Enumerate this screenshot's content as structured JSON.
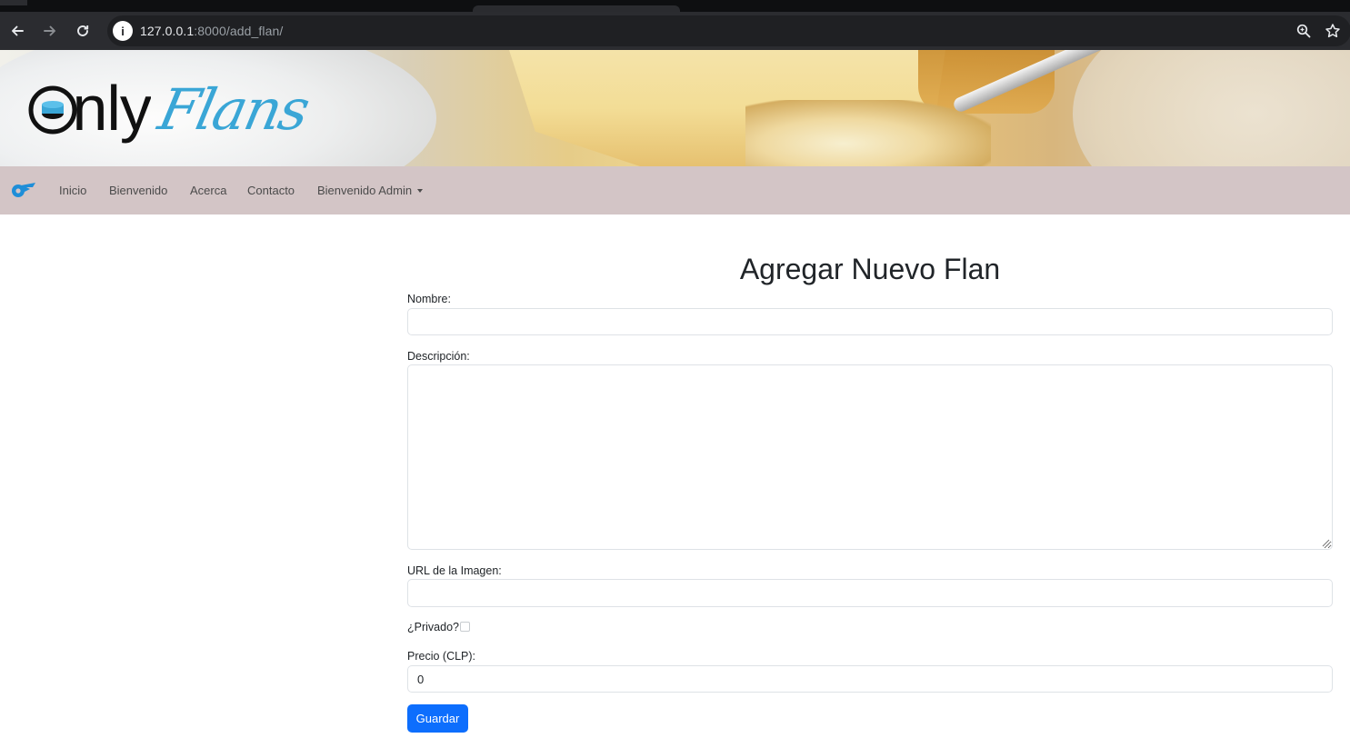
{
  "browser": {
    "url_host": "127.0.0.1",
    "url_path": ":8000/add_flan/"
  },
  "banner": {
    "logo_text_main": "Only",
    "logo_text_script": "Flans"
  },
  "navbar": {
    "items": [
      {
        "label": "Inicio"
      },
      {
        "label": "Bienvenido"
      },
      {
        "label": "Acerca"
      },
      {
        "label": "Contacto"
      },
      {
        "label": "Bienvenido Admin"
      }
    ]
  },
  "form": {
    "title": "Agregar Nuevo Flan",
    "nombre_label": "Nombre:",
    "nombre_value": "",
    "descripcion_label": "Descripción:",
    "descripcion_value": "",
    "imagen_label": "URL de la Imagen:",
    "imagen_value": "",
    "privado_label": "¿Privado?",
    "privado_checked": false,
    "precio_label": "Precio (CLP):",
    "precio_value": "0",
    "submit_label": "Guardar"
  },
  "colors": {
    "navbar_bg": "#d3c5c6",
    "primary": "#0d6efd",
    "logo_accent": "#3aa6d6"
  }
}
